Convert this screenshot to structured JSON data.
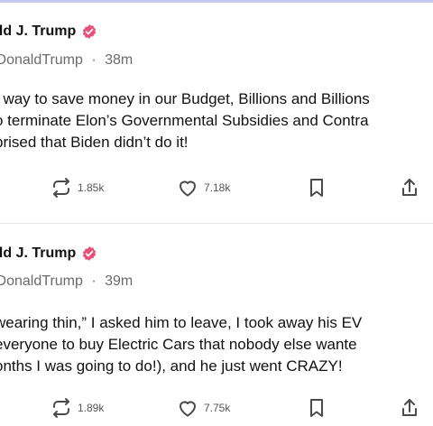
{
  "posts": [
    {
      "author_name": "ald J. Trump",
      "handle": "lDonaldTrump",
      "time": "38m",
      "lines": [
        "t way to save money in our Budget, Billions and Billions",
        "o terminate Elon’s Governmental Subsidies and Contra",
        "prised that Biden didn’t do it!"
      ],
      "reposts": "1.85k",
      "likes": "7.18k"
    },
    {
      "author_name": "ald J. Trump",
      "handle": "lDonaldTrump",
      "time": "39m",
      "lines": [
        "wearing thin,” I asked him to leave, I took away his EV",
        "everyone to buy Electric Cars that nobody else wante",
        "onths I was going to do!), and he just went CRAZY!"
      ],
      "reposts": "1.89k",
      "likes": "7.75k"
    }
  ],
  "separator": "·",
  "colors": {
    "verified_badge": "#e8507a",
    "text": "#111111",
    "muted": "#6b6b6b",
    "top_bar": "#c5c8f2"
  }
}
